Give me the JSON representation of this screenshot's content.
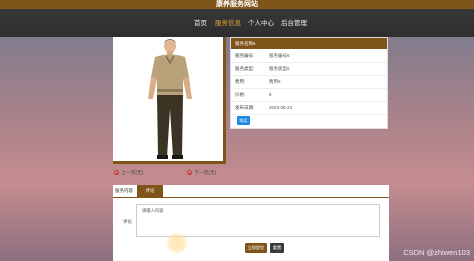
{
  "header": {
    "site_title": "康养服务网站",
    "nav": [
      {
        "label": "首页"
      },
      {
        "label": "服务信息"
      },
      {
        "label": "个人中心"
      },
      {
        "label": "后台管理"
      }
    ],
    "active_nav": "服务信息"
  },
  "info_panel": {
    "title": "服务名称6",
    "rows": [
      {
        "key": "服务编号:",
        "value": "服务编号6"
      },
      {
        "key": "服务类型:",
        "value": "服务类型6"
      },
      {
        "key": "费用:",
        "value": "费用6"
      },
      {
        "key": "价格:",
        "value": "6"
      },
      {
        "key": "发布日期:",
        "value": "2023-05-23"
      }
    ],
    "action_button": "购买"
  },
  "pager": {
    "prev": "上一页(无)",
    "next": "下一页(无)"
  },
  "tabs": [
    {
      "label": "服务内容"
    },
    {
      "label": "评论"
    }
  ],
  "active_tab": "评论",
  "comment": {
    "label": "评论",
    "placeholder": "请输入内容",
    "submit": "立即提交",
    "reset": "重置"
  },
  "watermark": "CSDN @zhiwen103",
  "colors": {
    "brand": "#7e5418",
    "topbar": "#2e2e2e",
    "nav_active": "#e3a531",
    "button_primary": "#1e88e5"
  }
}
